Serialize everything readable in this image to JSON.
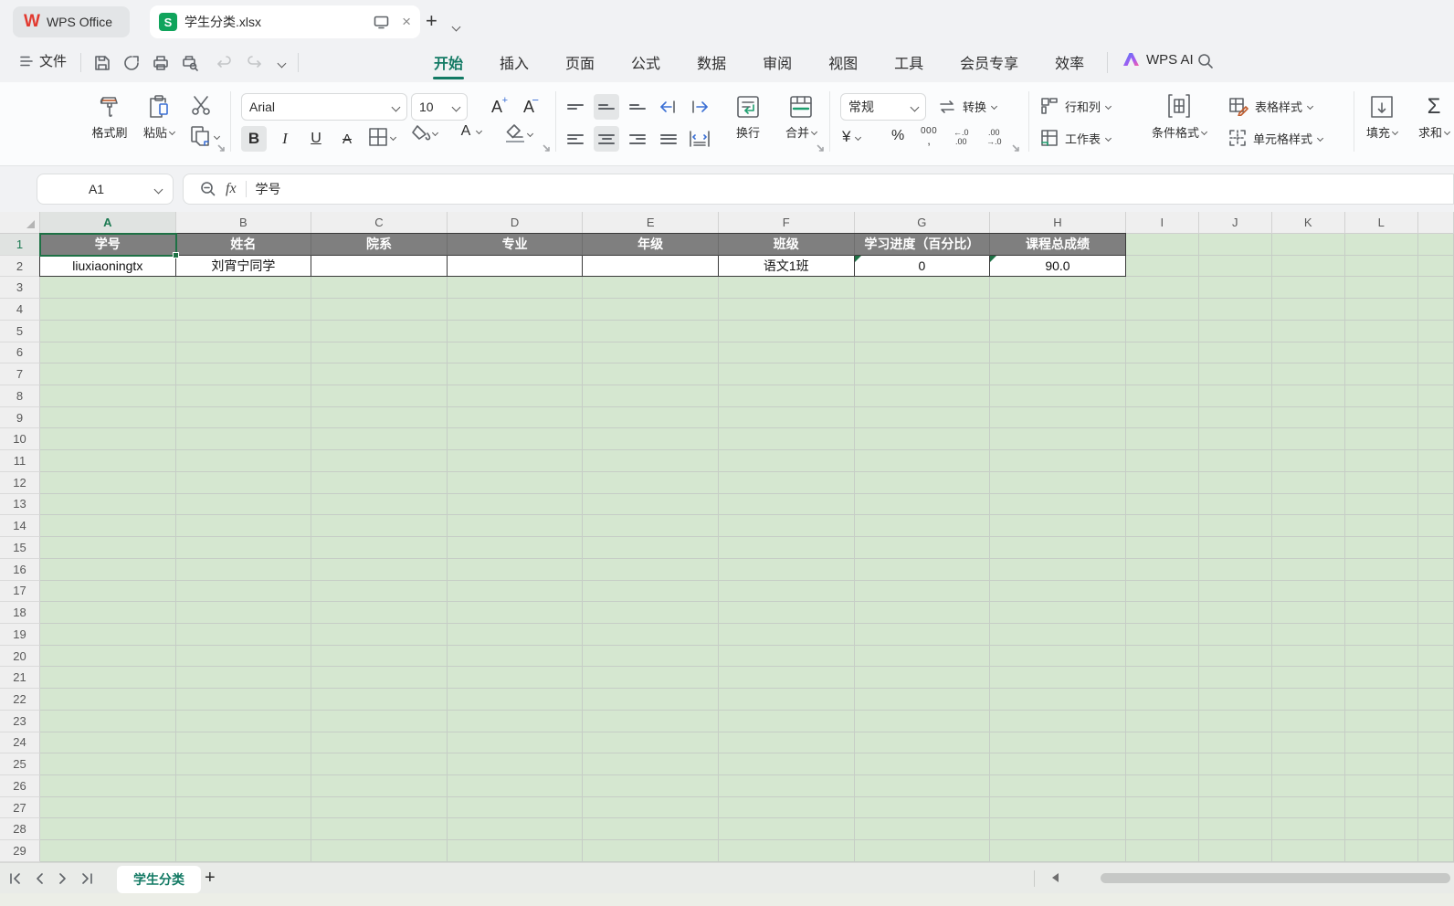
{
  "app": {
    "name": "WPS Office",
    "doc_title": "学生分类.xlsx"
  },
  "menu": {
    "file": "文件",
    "tabs": [
      "开始",
      "插入",
      "页面",
      "公式",
      "数据",
      "审阅",
      "视图",
      "工具",
      "会员专享",
      "效率"
    ],
    "active_tab": "开始",
    "ai_label": "WPS AI"
  },
  "toolbar": {
    "format_painter": "格式刷",
    "paste": "粘贴",
    "font_name": "Arial",
    "font_size": "10",
    "bold": "B",
    "italic": "I",
    "underline": "U",
    "wrap": "换行",
    "merge": "合并",
    "number_format": "常规",
    "convert": "转换",
    "currency": "¥",
    "percent": "%",
    "thousands": "000",
    "rows_cols": "行和列",
    "worksheet": "工作表",
    "conditional_format": "条件格式",
    "table_style": "表格样式",
    "cell_style": "单元格样式",
    "fill": "填充",
    "sum": "求和"
  },
  "formula_bar": {
    "cell_ref": "A1",
    "fx_label": "fx",
    "value": "学号"
  },
  "grid": {
    "column_letters": [
      "A",
      "B",
      "C",
      "D",
      "E",
      "F",
      "G",
      "H",
      "I",
      "J",
      "K",
      "L"
    ],
    "selected_cell": "A1",
    "selected_column": "A",
    "selected_row": 1,
    "visible_rows": 29,
    "table_header": [
      "学号",
      "姓名",
      "院系",
      "专业",
      "年级",
      "班级",
      "学习进度（百分比）",
      "课程总成绩"
    ],
    "table_data": [
      "liuxiaoningtx",
      "刘宵宁同学",
      "",
      "",
      "",
      "语文1班",
      "0",
      "90.0"
    ],
    "error_flag_columns": [
      6,
      7
    ]
  },
  "sheet_bar": {
    "active_sheet": "学生分类"
  },
  "colors": {
    "accent_teal": "#137a64",
    "selection_green": "#1e7145",
    "table_header_gray": "#7f7f7f",
    "sheet_green": "#d5e7d0",
    "highlight_yellow": "#f0d416",
    "font_color_red": "#d93025",
    "doc_icon_green": "#10a45c",
    "logo_red": "#e2392f"
  }
}
